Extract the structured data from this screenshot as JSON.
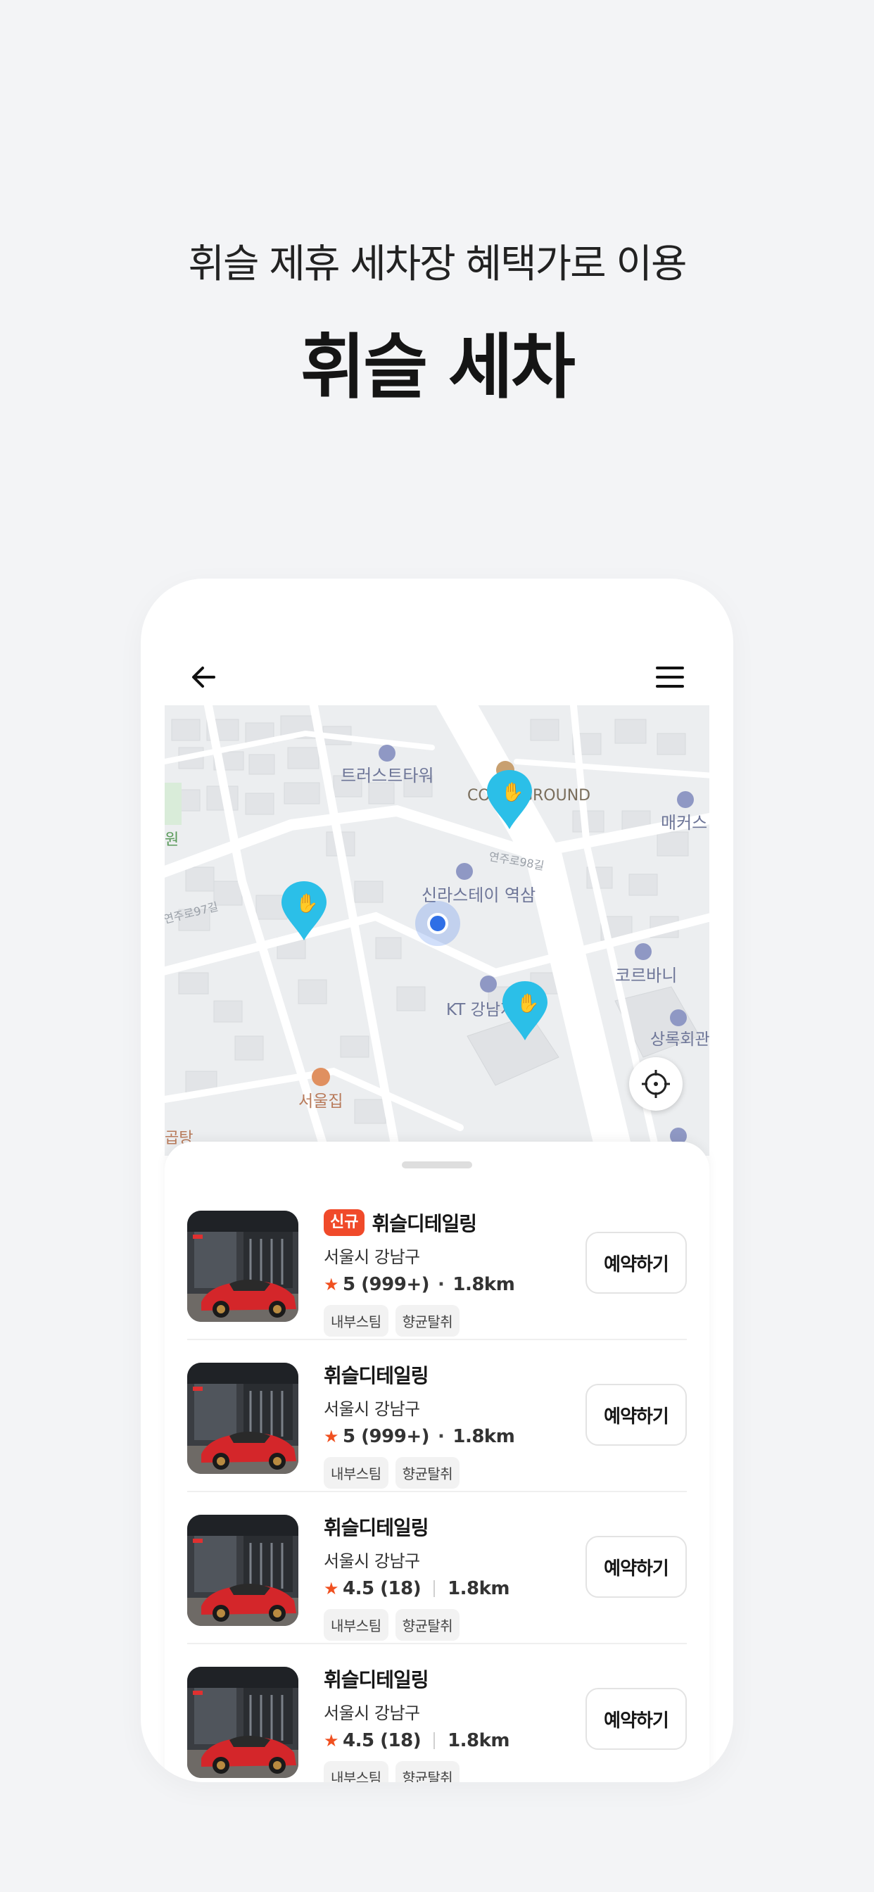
{
  "header": {
    "subtitle": "휘슬 제휴 세차장 혜택가로 이용",
    "title": "휘슬 세차"
  },
  "map": {
    "places": [
      "트러스트타워",
      "COMO GROUND",
      "매커스",
      "연주로98길",
      "신라스테이 역삼",
      "KT 강남지사",
      "코르바니",
      "상록회관 우체국",
      "서울집",
      "연주로97길",
      "원",
      "곱탕"
    ],
    "accent": "#2bbfe8",
    "current_location_color": "#2f6fe6"
  },
  "shops": [
    {
      "badge": "신규",
      "name": "휘슬디테일링",
      "address": "서울시 강남구",
      "rating": "5 (999+)",
      "distance": "1.8km",
      "separator": "dot",
      "tags": [
        "내부스팀",
        "향균탈취"
      ],
      "button": "예약하기"
    },
    {
      "badge": "",
      "name": "휘슬디테일링",
      "address": "서울시 강남구",
      "rating": "5 (999+)",
      "distance": "1.8km",
      "separator": "dot",
      "tags": [
        "내부스팀",
        "향균탈취"
      ],
      "button": "예약하기"
    },
    {
      "badge": "",
      "name": "휘슬디테일링",
      "address": "서울시 강남구",
      "rating": "4.5 (18)",
      "distance": "1.8km",
      "separator": "bar",
      "tags": [
        "내부스팀",
        "향균탈취"
      ],
      "button": "예약하기"
    },
    {
      "badge": "",
      "name": "휘슬디테일링",
      "address": "서울시 강남구",
      "rating": "4.5 (18)",
      "distance": "1.8km",
      "separator": "bar",
      "tags": [
        "내부스팀",
        "향균탈취"
      ],
      "button": "예약하기"
    }
  ],
  "colors": {
    "badge": "#f04a2a",
    "star": "#f05020"
  }
}
